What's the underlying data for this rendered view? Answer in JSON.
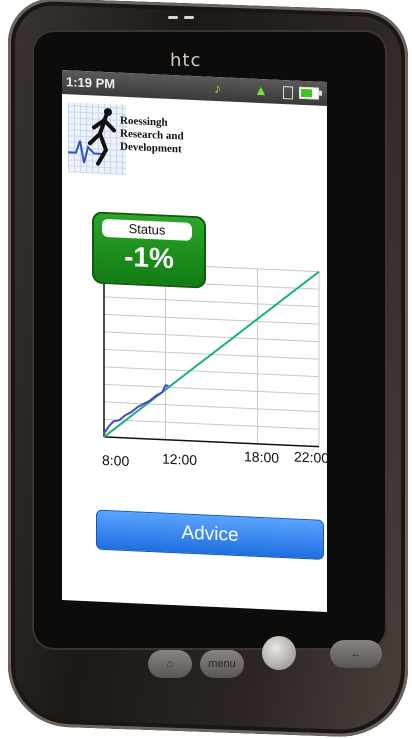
{
  "device": {
    "brand": "htc"
  },
  "status_bar": {
    "time": "1:19 PM",
    "icons": [
      "volume-icon",
      "signal-icon",
      "phone-icon",
      "battery-icon"
    ],
    "battery_level": 0.7,
    "icon_color": "#7adf3a"
  },
  "header": {
    "logo_lines": [
      "Roessingh",
      "Research and",
      "Development"
    ]
  },
  "status_card": {
    "label": "Status",
    "value": "-1%",
    "color": "#1f961f"
  },
  "chart_data": {
    "type": "line",
    "x_ticks": [
      "8:00",
      "12:00",
      "18:00",
      "22:00"
    ],
    "x": [
      8,
      22
    ],
    "ylim": [
      0,
      100
    ],
    "grid": true,
    "series": [
      {
        "color": "#19b27a",
        "x": [
          8,
          22
        ],
        "y": [
          0,
          100
        ]
      },
      {
        "color": "#4a4ac8",
        "x": [
          8,
          8.3,
          8.6,
          9,
          9.4,
          9.8,
          10.2,
          10.6,
          11,
          11.4,
          11.8,
          12,
          12.2
        ],
        "y": [
          2,
          6,
          9,
          10,
          13,
          15,
          18,
          20,
          22,
          25,
          27,
          31,
          31
        ]
      }
    ]
  },
  "actions": {
    "advice_label": "Advice",
    "advice_color": "#2a7be8"
  },
  "hardware_buttons": {
    "menu_label": "menu"
  }
}
